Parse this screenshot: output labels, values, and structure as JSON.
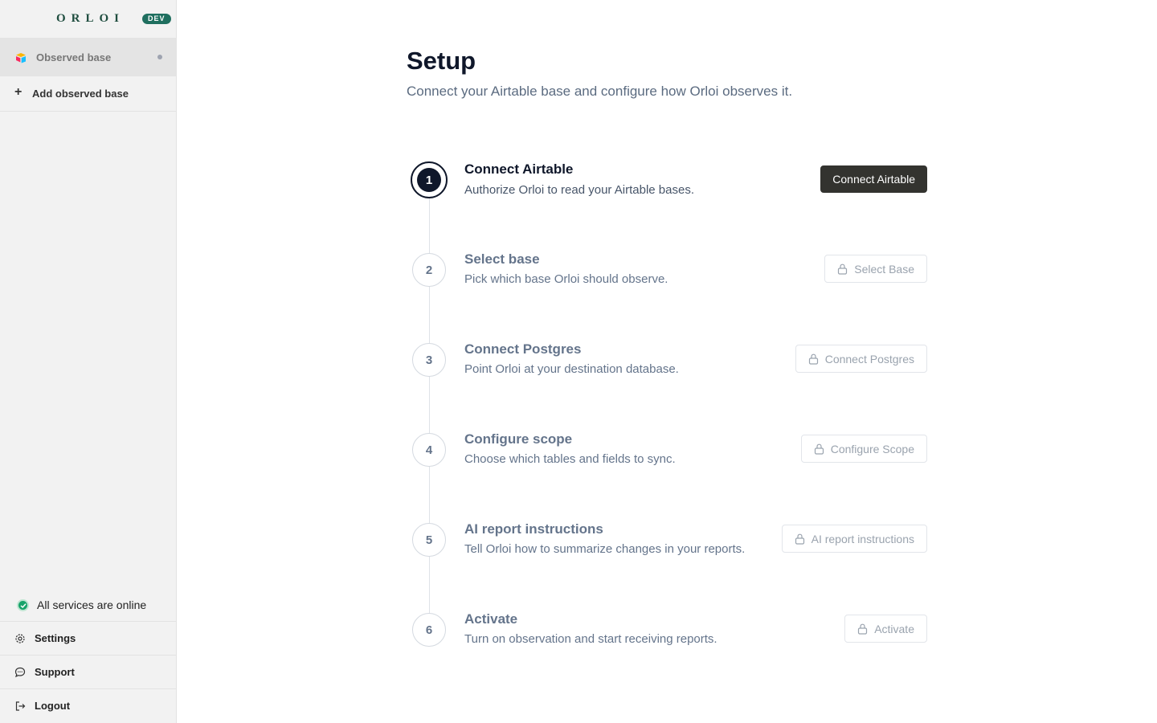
{
  "brand": {
    "name": "ORLOI",
    "env_badge": "DEV"
  },
  "sidebar": {
    "items": [
      {
        "label": "Observed base",
        "active": true
      },
      {
        "label": "Add observed base"
      }
    ],
    "status": {
      "label": "All services are online",
      "color": "#18a36a"
    },
    "bottom": [
      {
        "label": "Settings"
      },
      {
        "label": "Support"
      },
      {
        "label": "Logout"
      }
    ]
  },
  "main": {
    "title": "Setup",
    "subtitle": "Connect your Airtable base and configure how Orloi observes it.",
    "steps": [
      {
        "number": "1",
        "title": "Connect Airtable",
        "description": "Authorize Orloi to read your Airtable bases.",
        "button": "Connect Airtable",
        "locked": false
      },
      {
        "number": "2",
        "title": "Select base",
        "description": "Pick which base Orloi should observe.",
        "button": "Select Base",
        "locked": true
      },
      {
        "number": "3",
        "title": "Connect Postgres",
        "description": "Point Orloi at your destination database.",
        "button": "Connect Postgres",
        "locked": true
      },
      {
        "number": "4",
        "title": "Configure scope",
        "description": "Choose which tables and fields to sync.",
        "button": "Configure Scope",
        "locked": true
      },
      {
        "number": "5",
        "title": "AI report instructions",
        "description": "Tell Orloi how to summarize changes in your reports.",
        "button": "AI report instructions",
        "locked": true
      },
      {
        "number": "6",
        "title": "Activate",
        "description": "Turn on observation and start receiving reports.",
        "button": "Activate",
        "locked": true
      }
    ]
  },
  "colors": {
    "accent": "#0f172a",
    "primary_button": "#33332f",
    "brand": "#1f4d3f",
    "badge": "#1f6f5f"
  }
}
